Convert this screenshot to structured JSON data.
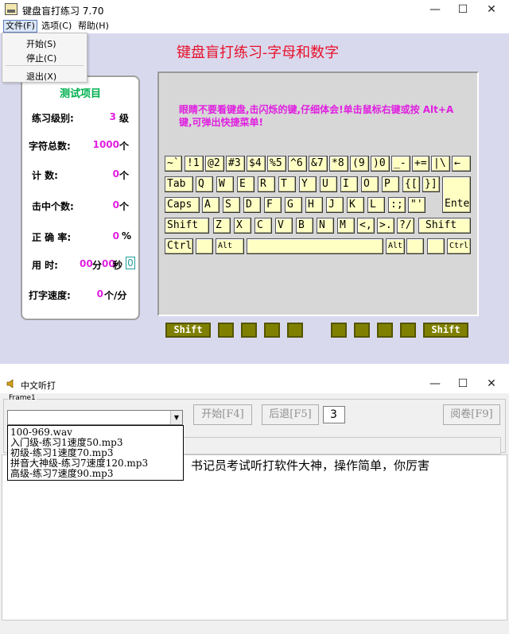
{
  "window1": {
    "title": "键盘盲打练习 7.70",
    "controls": {
      "minimize": "—",
      "maximize": "☐",
      "close": "✕"
    },
    "menu": [
      "文件(F)",
      "选项(C)",
      "帮助(H)"
    ],
    "file_menu_items": [
      "开始(S)",
      "停止(C)",
      "退出(X)"
    ],
    "heading": "键盘盲打练习-字母和数字",
    "stats": {
      "title": "测试项目",
      "level_label": "练习级别:",
      "level_value": "3",
      "level_unit": "级",
      "total_label": "字符总数:",
      "total_value": "1000",
      "total_unit": "个",
      "count_label": "计    数:",
      "count_value": "0",
      "count_unit": "个",
      "hit_label": "击中个数:",
      "hit_value": "0",
      "hit_unit": "个",
      "accuracy_label": "正 确 率:",
      "accuracy_value": "0",
      "accuracy_unit": "%",
      "time_label": "用    时:",
      "time_min": "00",
      "time_min_unit": "分",
      "time_sec": "00",
      "time_sec_unit": "秒",
      "time_box": "0",
      "speed_label": "打字速度:",
      "speed_value": "0",
      "speed_unit": "个/分"
    },
    "message": "眼睛不要看键盘,击闪烁的键,仔细体会!单击鼠标右键或按 Alt+A 键,可弹出快捷菜单!",
    "keyboard": {
      "row1": [
        "~`",
        "!1",
        "@2",
        "#3",
        "$4",
        "%5",
        "^6",
        "&7",
        "*8",
        "(9",
        ")0",
        "_-",
        "+=",
        "|\\",
        "←"
      ],
      "row2": [
        "Tab",
        "Q",
        "W",
        "E",
        "R",
        "T",
        "Y",
        "U",
        "I",
        "O",
        "P",
        "{[",
        "}]"
      ],
      "enter": "Enter↵",
      "row3": [
        "Caps",
        "A",
        "S",
        "D",
        "F",
        "G",
        "H",
        "J",
        "K",
        "L",
        ":;",
        "\"'"
      ],
      "row4": [
        "Shift",
        "Z",
        "X",
        "C",
        "V",
        "B",
        "N",
        "M",
        "<,",
        ">.",
        "?/",
        "Shift"
      ],
      "row5": [
        "Ctrl",
        "",
        "Alt",
        "",
        "Alt",
        "",
        "",
        "Ctrl"
      ]
    },
    "finger_keys": {
      "left_shift": "Shift",
      "right_shift": "Shift"
    }
  },
  "window2": {
    "title": "中文听打",
    "controls": {
      "minimize": "—",
      "maximize": "☐",
      "close": "✕"
    },
    "frame_label": "Frame1",
    "combo_value": "",
    "list_items": [
      "100-969.wav",
      "入门级-练习1速度50.mp3",
      "初级-练习1速度70.mp3",
      "拼音大神级-练习7速度120.mp3",
      "高级-练习7速度90.mp3"
    ],
    "start_button": "开始[F4]",
    "back_button": "后退[F5]",
    "number_field": "3",
    "review_button": "阅卷[F9]",
    "text_content": "书记员考试听打软件大神，操作简单，你厉害"
  }
}
